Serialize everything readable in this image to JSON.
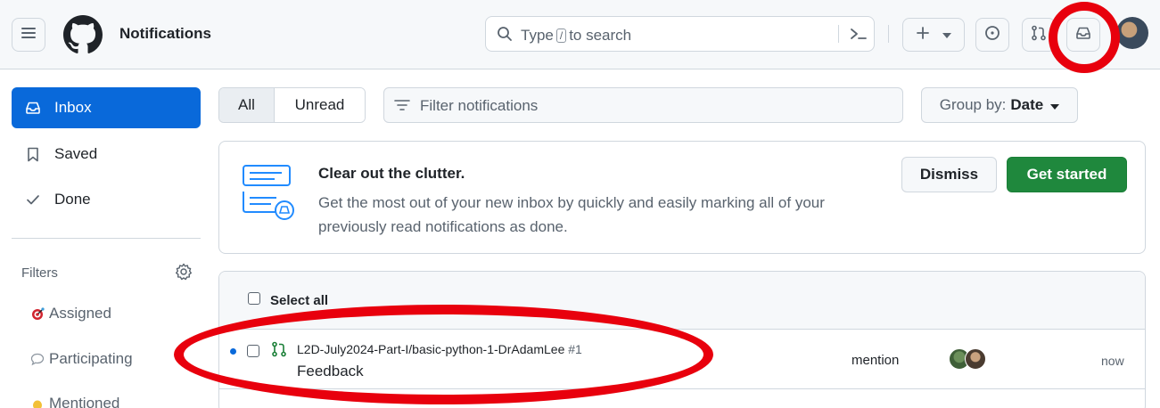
{
  "header": {
    "title": "Notifications",
    "search": {
      "prefix": "Type",
      "key": "/",
      "suffix": "to search"
    },
    "icons": [
      "hamburger-icon",
      "github-logo",
      "search-icon",
      "command-palette-icon",
      "plus-icon",
      "triangle-down-icon",
      "issue-icon",
      "pull-request-icon",
      "inbox-icon"
    ]
  },
  "sidebar": {
    "items": [
      {
        "label": "Inbox",
        "icon": "inbox-icon",
        "active": true
      },
      {
        "label": "Saved",
        "icon": "bookmark-icon"
      },
      {
        "label": "Done",
        "icon": "check-icon"
      }
    ],
    "filters_label": "Filters",
    "filters": [
      {
        "label": "Assigned",
        "icon": "target-icon"
      },
      {
        "label": "Participating",
        "icon": "speech-bubble-icon"
      },
      {
        "label": "Mentioned",
        "icon": "hand-icon"
      }
    ]
  },
  "toolbar": {
    "tabs": [
      "All",
      "Unread"
    ],
    "filter_placeholder": "Filter notifications",
    "group_by_label": "Group by:",
    "group_by_value": "Date"
  },
  "banner": {
    "title": "Clear out the clutter.",
    "body": "Get the most out of your new inbox by quickly and easily marking all of your previously read notifications as done.",
    "dismiss_label": "Dismiss",
    "cta_label": "Get started"
  },
  "list": {
    "select_all_label": "Select all",
    "rows": [
      {
        "repo": "L2D-July2024-Part-I/basic-python-1-DrAdamLee",
        "number": "#1",
        "title": "Feedback",
        "reason": "mention",
        "time": "now"
      }
    ]
  },
  "colors": {
    "accent": "#0969da",
    "primary_button": "#1f883d",
    "annotation": "#e8000d"
  }
}
